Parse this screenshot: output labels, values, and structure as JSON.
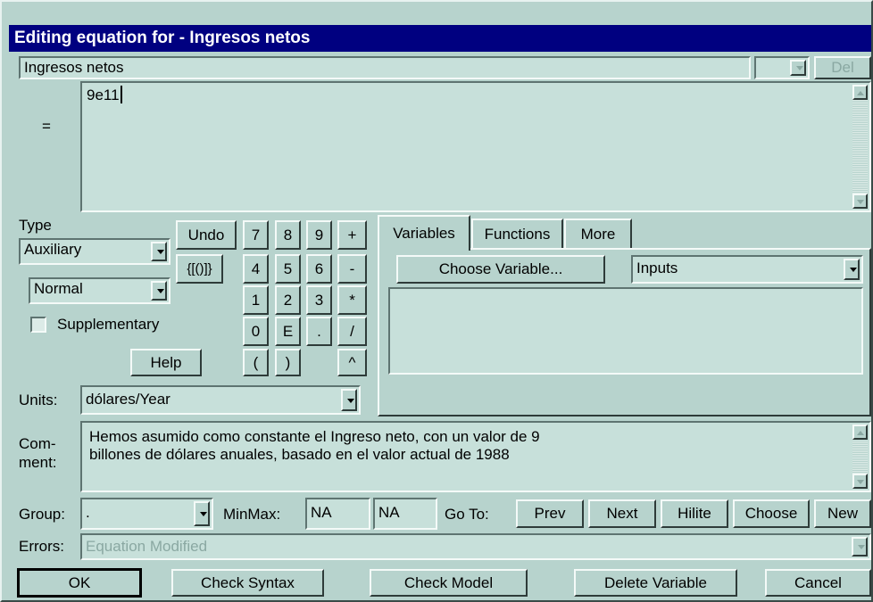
{
  "title": "Editing equation for - Ingresos netos",
  "variable_name": "Ingresos netos",
  "del_label": "Del",
  "equals_label": "=",
  "equation": "9e11",
  "type": {
    "label": "Type",
    "kind": "Auxiliary",
    "subtype": "Normal",
    "supplementary_label": "Supplementary",
    "supplementary_checked": false
  },
  "keypad": {
    "undo": "Undo",
    "brackets": "{[()]}",
    "help": "Help",
    "keys": [
      "7",
      "8",
      "9",
      "+",
      "4",
      "5",
      "6",
      "-",
      "1",
      "2",
      "3",
      "*",
      "0",
      "E",
      ".",
      "/",
      "(",
      ")",
      "^"
    ]
  },
  "tabs": [
    "Variables",
    "Functions",
    "More"
  ],
  "choose_variable": "Choose Variable...",
  "variable_filter": "Inputs",
  "units": {
    "label": "Units:",
    "value": "dólares/Year"
  },
  "comment": {
    "label_line1": "Com-",
    "label_line2": "ment:",
    "line1": "Hemos asumido como constante el Ingreso neto,  con un valor de 9",
    "line2": "billones de dólares anuales, basado en el valor actual de 1988"
  },
  "group": {
    "label": "Group:",
    "value": "."
  },
  "minmax": {
    "label": "MinMax:",
    "min": "NA",
    "max": "NA"
  },
  "goto": {
    "label": "Go To:",
    "prev": "Prev",
    "next": "Next",
    "hilite": "Hilite",
    "choose": "Choose",
    "new": "New"
  },
  "errors": {
    "label": "Errors:",
    "value": "Equation Modified"
  },
  "bottom_buttons": {
    "ok": "OK",
    "check_syntax": "Check Syntax",
    "check_model": "Check Model",
    "delete_variable": "Delete Variable",
    "cancel": "Cancel"
  },
  "colors": {
    "dialog_bg": "#b7d3cd",
    "field_bg": "#c7e0da",
    "titlebar": "#000080"
  }
}
